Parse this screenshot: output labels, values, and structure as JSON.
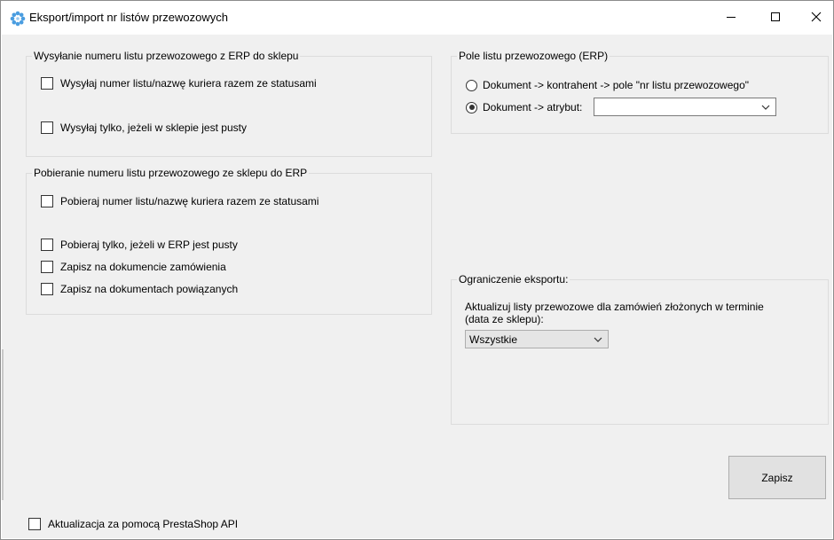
{
  "window": {
    "title": "Eksport/import nr listów przewozowych",
    "icon": "gear-flower-icon",
    "minimize_icon": "minimize-icon",
    "maximize_icon": "maximize-icon",
    "close_icon": "close-icon"
  },
  "send_group": {
    "title": "Wysyłanie numeru listu przewozowego z ERP do sklepu",
    "cb1": "Wysyłaj numer listu/nazwę kuriera razem ze statusami",
    "cb2": "Wysyłaj tylko, jeżeli w sklepie jest pusty"
  },
  "fetch_group": {
    "title": "Pobieranie numeru listu przewozowego ze sklepu do ERP",
    "cb1": "Pobieraj numer listu/nazwę kuriera razem ze statusami",
    "cb2": "Pobieraj tylko, jeżeli w ERP jest pusty",
    "cb3": "Zapisz na dokumencie zamówienia",
    "cb4": "Zapisz na dokumentach powiązanych"
  },
  "field_group": {
    "title": "Pole listu przewozowego (ERP)",
    "radio1": "Dokument -> kontrahent -> pole \"nr listu przewozowego\"",
    "radio2": "Dokument -> atrybut:",
    "selected_radio": 2,
    "attribute_value": ""
  },
  "limit_group": {
    "title": "Ograniczenie eksportu:",
    "description": "Aktualizuj listy przewozowe dla zamówień złożonych w terminie",
    "description2": "(data ze sklepu):",
    "select_value": "Wszystkie"
  },
  "footer": {
    "api_checkbox": "Aktualizacja za pomocą PrestaShop API",
    "save_label": "Zapisz"
  }
}
